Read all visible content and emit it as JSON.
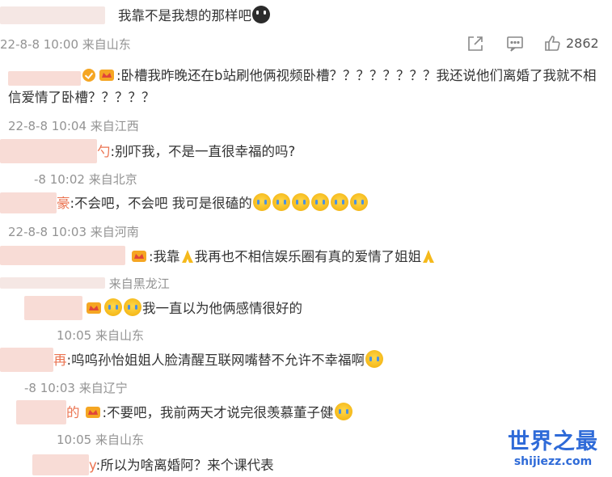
{
  "post": {
    "reply_text": "我靠不是我想的那样吧",
    "timestamp": "22-8-8 10:00",
    "source": "来自山东",
    "like_count": "2862"
  },
  "comments": [
    {
      "name_suffix": "",
      "body": ":卧槽我昨晚还在b站刷他俩视频卧槽？？？？？？？？我还说他们离婚了我就不相信爱情了卧槽？？？？？",
      "timestamp": "22-8-8 10:04",
      "source": "来自江西"
    },
    {
      "name_suffix": "勺",
      "body": ":别吓我，不是一直很幸福的吗?",
      "timestamp": "-8 10:02",
      "source": "来自北京"
    },
    {
      "name_suffix": "豪",
      "body": ":不会吧，不会吧 我可是很磕的",
      "timestamp": "22-8-8 10:03",
      "source": "来自河南"
    },
    {
      "name_suffix": "",
      "body": ":我靠",
      "body_2": "我再也不相信娱乐圈有真的爱情了姐姐",
      "timestamp": "",
      "source": "来自黑龙江"
    },
    {
      "name_suffix": "",
      "body": "我一直以为他俩感情很好的",
      "timestamp": "10:05",
      "source": "来自山东"
    },
    {
      "name_suffix": "再",
      "body": ":呜呜孙怡姐姐人脸清醒互联网嘴替不允许不幸福啊",
      "timestamp": "-8 10:03",
      "source": "来自辽宁"
    },
    {
      "name_suffix": "的",
      "body": ":不要吧，我前两天才说完很羡慕董子健",
      "timestamp": "10:05",
      "source": "来自山东"
    },
    {
      "name_suffix": "y",
      "body": ":所以为啥离婚阿？来个课代表",
      "timestamp": "",
      "source": ""
    }
  ],
  "watermark": {
    "title": "世界之最",
    "subtitle": "shijiezz.com"
  },
  "icons": {
    "share": "share-icon",
    "comment": "comment-icon",
    "like": "thumbs-up-icon"
  },
  "colors": {
    "username": "#eb7350",
    "meta": "#939393",
    "watermark": "#2f6bd8"
  }
}
